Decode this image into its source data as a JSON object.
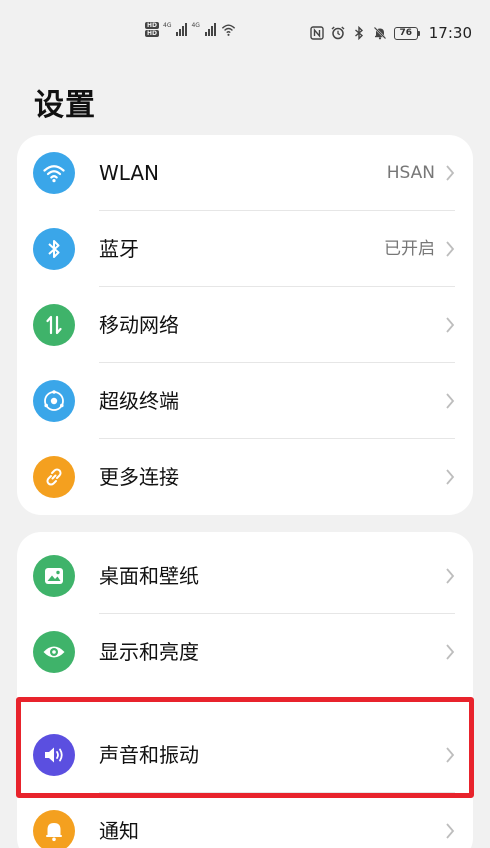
{
  "status_bar": {
    "hd_badges": [
      "HD",
      "HD"
    ],
    "network_labels": [
      "4G",
      "4G"
    ],
    "battery": "76",
    "time": "17:30",
    "icons": [
      "nfc-icon",
      "alarm-icon",
      "bluetooth-icon",
      "mute-icon"
    ]
  },
  "title": "设置",
  "groups": [
    {
      "items": [
        {
          "label": "WLAN",
          "value": "HSAN",
          "icon": "wifi-icon",
          "color": "#3aa6e9"
        },
        {
          "label": "蓝牙",
          "value": "已开启",
          "icon": "bluetooth-icon",
          "color": "#3aa6e9"
        },
        {
          "label": "移动网络",
          "value": "",
          "icon": "mobile-data-icon",
          "color": "#3fb36a"
        },
        {
          "label": "超级终端",
          "value": "",
          "icon": "super-device-icon",
          "color": "#3aa6e9"
        },
        {
          "label": "更多连接",
          "value": "",
          "icon": "link-icon",
          "color": "#f4a01f"
        }
      ]
    },
    {
      "items": [
        {
          "label": "桌面和壁纸",
          "value": "",
          "icon": "wallpaper-icon",
          "color": "#3fb36a"
        },
        {
          "label": "显示和亮度",
          "value": "",
          "icon": "eye-icon",
          "color": "#3fb36a"
        },
        {
          "label": "声音和振动",
          "value": "",
          "icon": "speaker-icon",
          "color": "#5b4fe0"
        },
        {
          "label": "通知",
          "value": "",
          "icon": "bell-icon",
          "color": "#f4a01f"
        }
      ]
    }
  ],
  "highlight_color": "#e8232c"
}
